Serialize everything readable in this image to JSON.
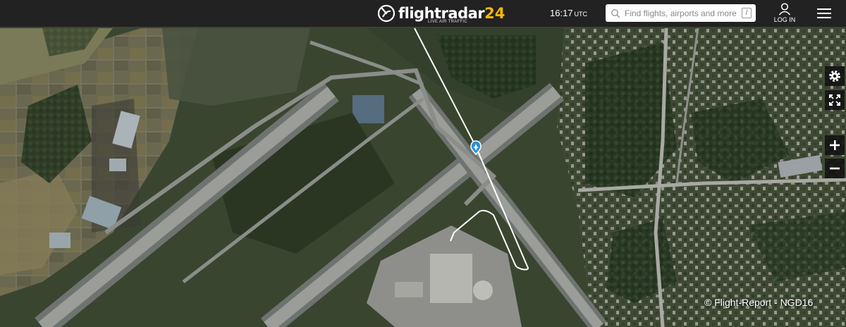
{
  "header": {
    "logo_text": "flightradar",
    "logo_number": "24",
    "logo_tagline": "LIVE AIR TRAFFIC",
    "clock_time": "16:17",
    "clock_zone": "UTC",
    "search_placeholder": "Find flights, airports and more",
    "search_shortcut": "/",
    "login_label": "LOG IN"
  },
  "map": {
    "credit": "© Flight-Report - NGD16"
  },
  "colors": {
    "topbar": "#222222",
    "logo_accent": "#f5b800",
    "flight_path": "#ffffff",
    "aircraft_marker": "#2a8fd6"
  }
}
